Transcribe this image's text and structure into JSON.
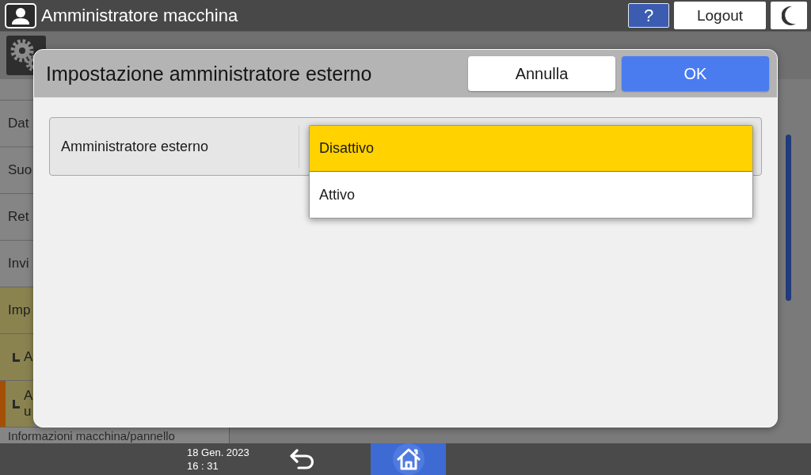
{
  "top_bar": {
    "title": "Amministratore macchina",
    "help_button": "?",
    "logout_button": "Logout"
  },
  "sidebar": {
    "items": [
      {
        "label": "Dat",
        "selected": false,
        "expanded": false
      },
      {
        "label": "Suo",
        "selected": false,
        "expanded": false
      },
      {
        "label": "Ret",
        "selected": false,
        "expanded": false
      },
      {
        "label": "Invi",
        "selected": false,
        "expanded": false
      },
      {
        "label": "Imp",
        "selected": false,
        "expanded": true,
        "children": [
          {
            "label": "A",
            "selected": false
          },
          {
            "label": "A\nu",
            "selected": true
          }
        ]
      },
      {
        "label": "Informazioni macchina/pannello",
        "selected": false,
        "expanded": false
      }
    ]
  },
  "dialog": {
    "title": "Impostazione amministratore esterno",
    "buttons": [
      {
        "label": "Annulla",
        "kind": "cancel"
      },
      {
        "label": "OK",
        "kind": "ok"
      }
    ],
    "setting": {
      "label": "Amministratore esterno",
      "options": [
        {
          "label": "Disattivo",
          "selected": true
        },
        {
          "label": "Attivo",
          "selected": false
        }
      ]
    }
  },
  "bottom_bar": {
    "date": "18 Gen. 2023",
    "time": "16 : 31"
  }
}
